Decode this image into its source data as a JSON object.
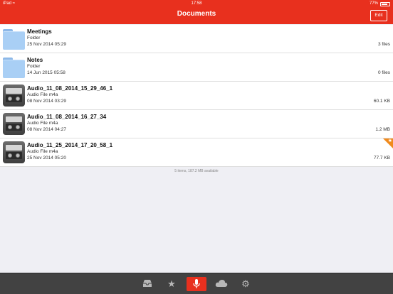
{
  "status_bar": {
    "carrier": "iPad",
    "time": "17:58",
    "battery": "77%"
  },
  "header": {
    "title": "Documents",
    "edit_label": "Edit"
  },
  "items": [
    {
      "name": "Meetings",
      "type": "Folder",
      "date": "25 Nov 2014 05:29",
      "meta": "3 files",
      "icon": "folder-icon"
    },
    {
      "name": "Notes",
      "type": "Folder",
      "date": "14 Jun 2015 05:58",
      "meta": "0 files",
      "icon": "folder-icon"
    },
    {
      "name": "Audio_11_08_2014_15_29_46_1",
      "type": "Audio File m4a",
      "date": "08 Nov 2014 03:29",
      "meta": "60.1 KB",
      "icon": "recorder-icon"
    },
    {
      "name": "Audio_11_08_2014_16_27_34",
      "type": "Audio File m4a",
      "date": "08 Nov 2014 04:27",
      "meta": "1.2 MB",
      "icon": "recorder-icon"
    },
    {
      "name": "Audio_11_25_2014_17_20_58_1",
      "type": "Audio File m4a",
      "date": "25 Nov 2014 05:20",
      "meta": "77.7 KB",
      "icon": "recorder-icon",
      "starred": true
    }
  ],
  "footer": {
    "summary": "5 items, 187.2 MB available"
  },
  "tabbar": {
    "tabs": [
      "inbox-icon",
      "star-icon",
      "microphone-icon",
      "cloud-icon",
      "gear-icon"
    ],
    "active": "microphone-icon"
  },
  "colors": {
    "accent": "#e8301e",
    "star_badge": "#f08a1c",
    "tabbar": "#424242"
  }
}
